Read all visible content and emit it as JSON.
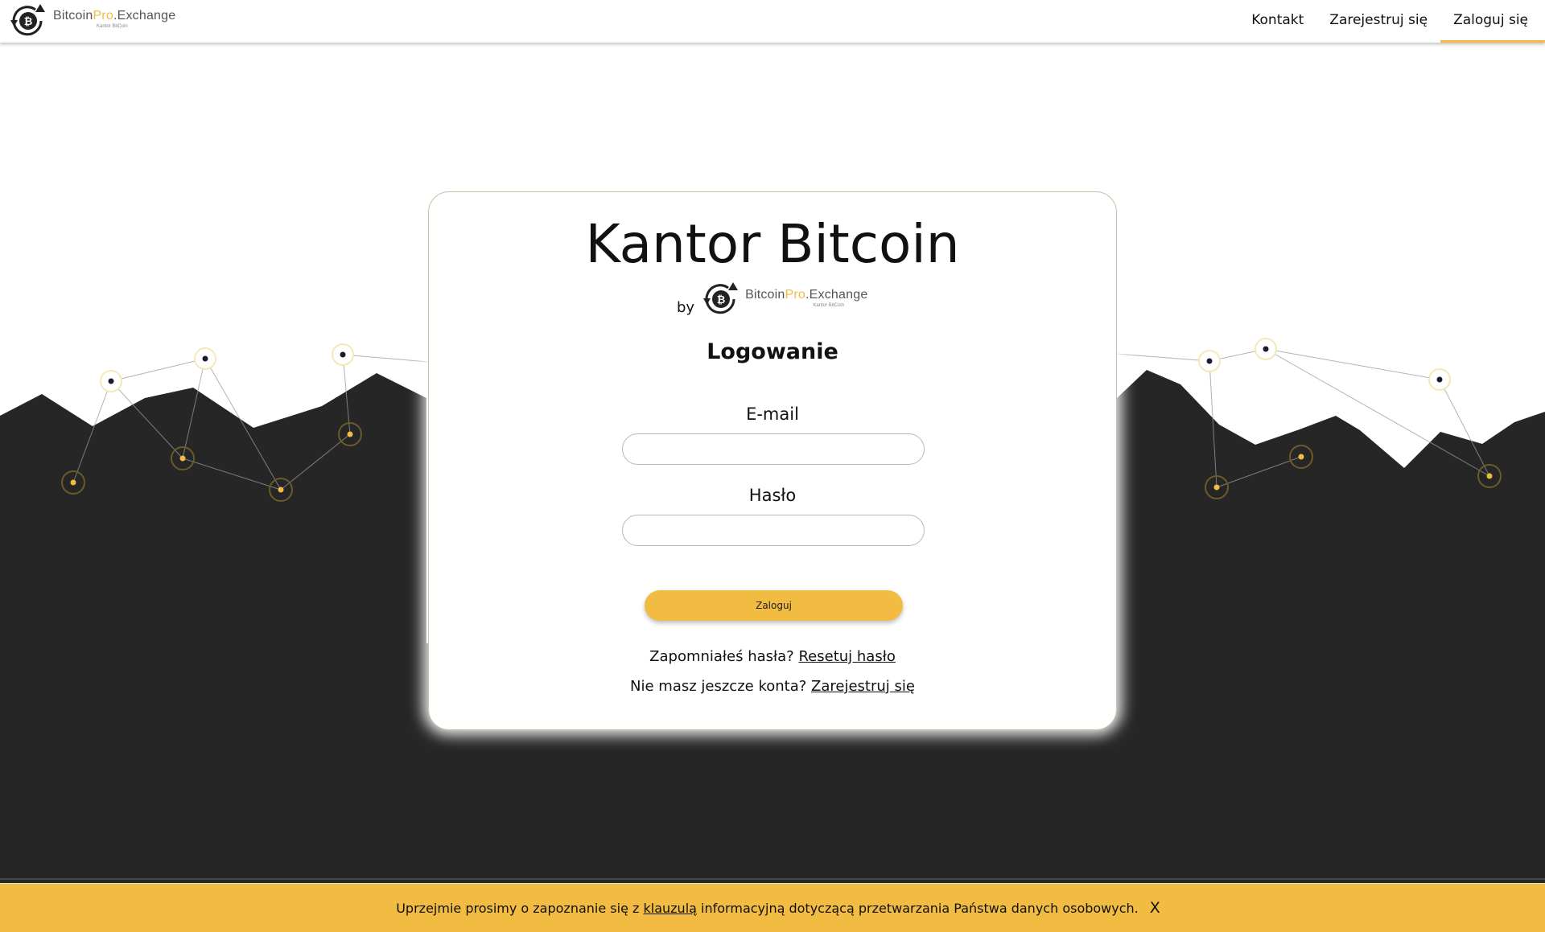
{
  "brand": {
    "name_part1": "Bitcoin",
    "name_part2": "Pro",
    "name_part3": ".Exchange",
    "tagline": "Kantor BitCoin",
    "logo_icon": "bitcoin-exchange-logo-icon"
  },
  "nav": {
    "items": [
      {
        "label": "Kontakt"
      },
      {
        "label": "Zarejestruj się"
      },
      {
        "label": "Zaloguj się"
      }
    ],
    "active_index": 2
  },
  "card": {
    "title": "Kantor Bitcoin",
    "by_label": "by",
    "form_title": "Logowanie",
    "email_label": "E-mail",
    "email_value": "",
    "password_label": "Hasło",
    "password_value": "",
    "submit_label": "Zaloguj",
    "forgot_prefix": "Zapomniałeś hasła?",
    "forgot_link": "Resetuj hasło",
    "register_prefix": "Nie masz jeszcze konta?",
    "register_link": "Zarejestruj się"
  },
  "cookie_bar": {
    "text_before": "Uprzejmie prosimy o zapoznanie się z",
    "link": "klauzulą",
    "text_after": "informacyjną dotyczącą przetwarzania Państwa danych osobowych.",
    "close_label": "X"
  },
  "colors": {
    "accent": "#f2bc42",
    "dark_background": "#262626",
    "node_dark": "#1b1b2b"
  }
}
